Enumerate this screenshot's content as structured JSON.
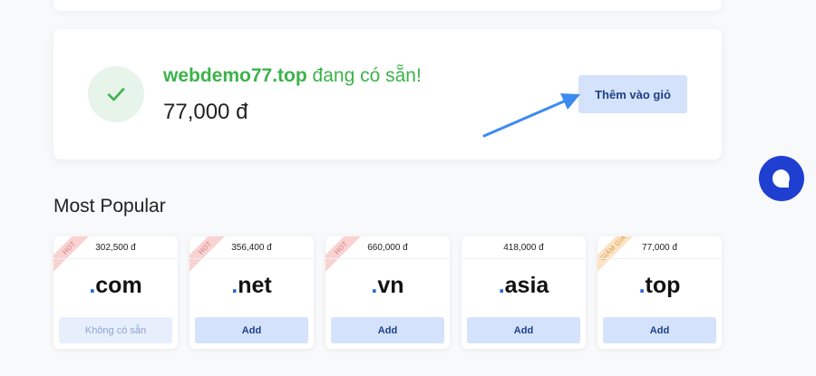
{
  "result": {
    "domain": "webdemo77.top",
    "availability_text": " đang có sẵn!",
    "price": "77,000 đ",
    "add_to_cart_label": "Thêm vào giỏ"
  },
  "section_title": "Most Popular",
  "tlds": [
    {
      "badge": "HOT",
      "price": "302,500 đ",
      "dot": ".",
      "name": "com",
      "button": "Không có sẵn"
    },
    {
      "badge": "HOT",
      "price": "356,400 đ",
      "dot": ".",
      "name": "net",
      "button": "Add"
    },
    {
      "badge": "HOT",
      "price": "660,000 đ",
      "dot": ".",
      "name": "vn",
      "button": "Add"
    },
    {
      "badge": "",
      "price": "418,000 đ",
      "dot": ".",
      "name": "asia",
      "button": "Add"
    },
    {
      "badge": "GIẢM GIÁ",
      "price": "77,000 đ",
      "dot": ".",
      "name": "top",
      "button": "Add"
    }
  ],
  "colors": {
    "available_green": "#3cb34a",
    "button_bg": "#d4e2fb",
    "button_text": "#1c3f86",
    "chat_bg": "#1f3fd1",
    "arrow": "#3d8bf2"
  },
  "icons": {
    "check": "check-icon",
    "arrow": "arrow-icon",
    "chat": "chat-icon"
  }
}
